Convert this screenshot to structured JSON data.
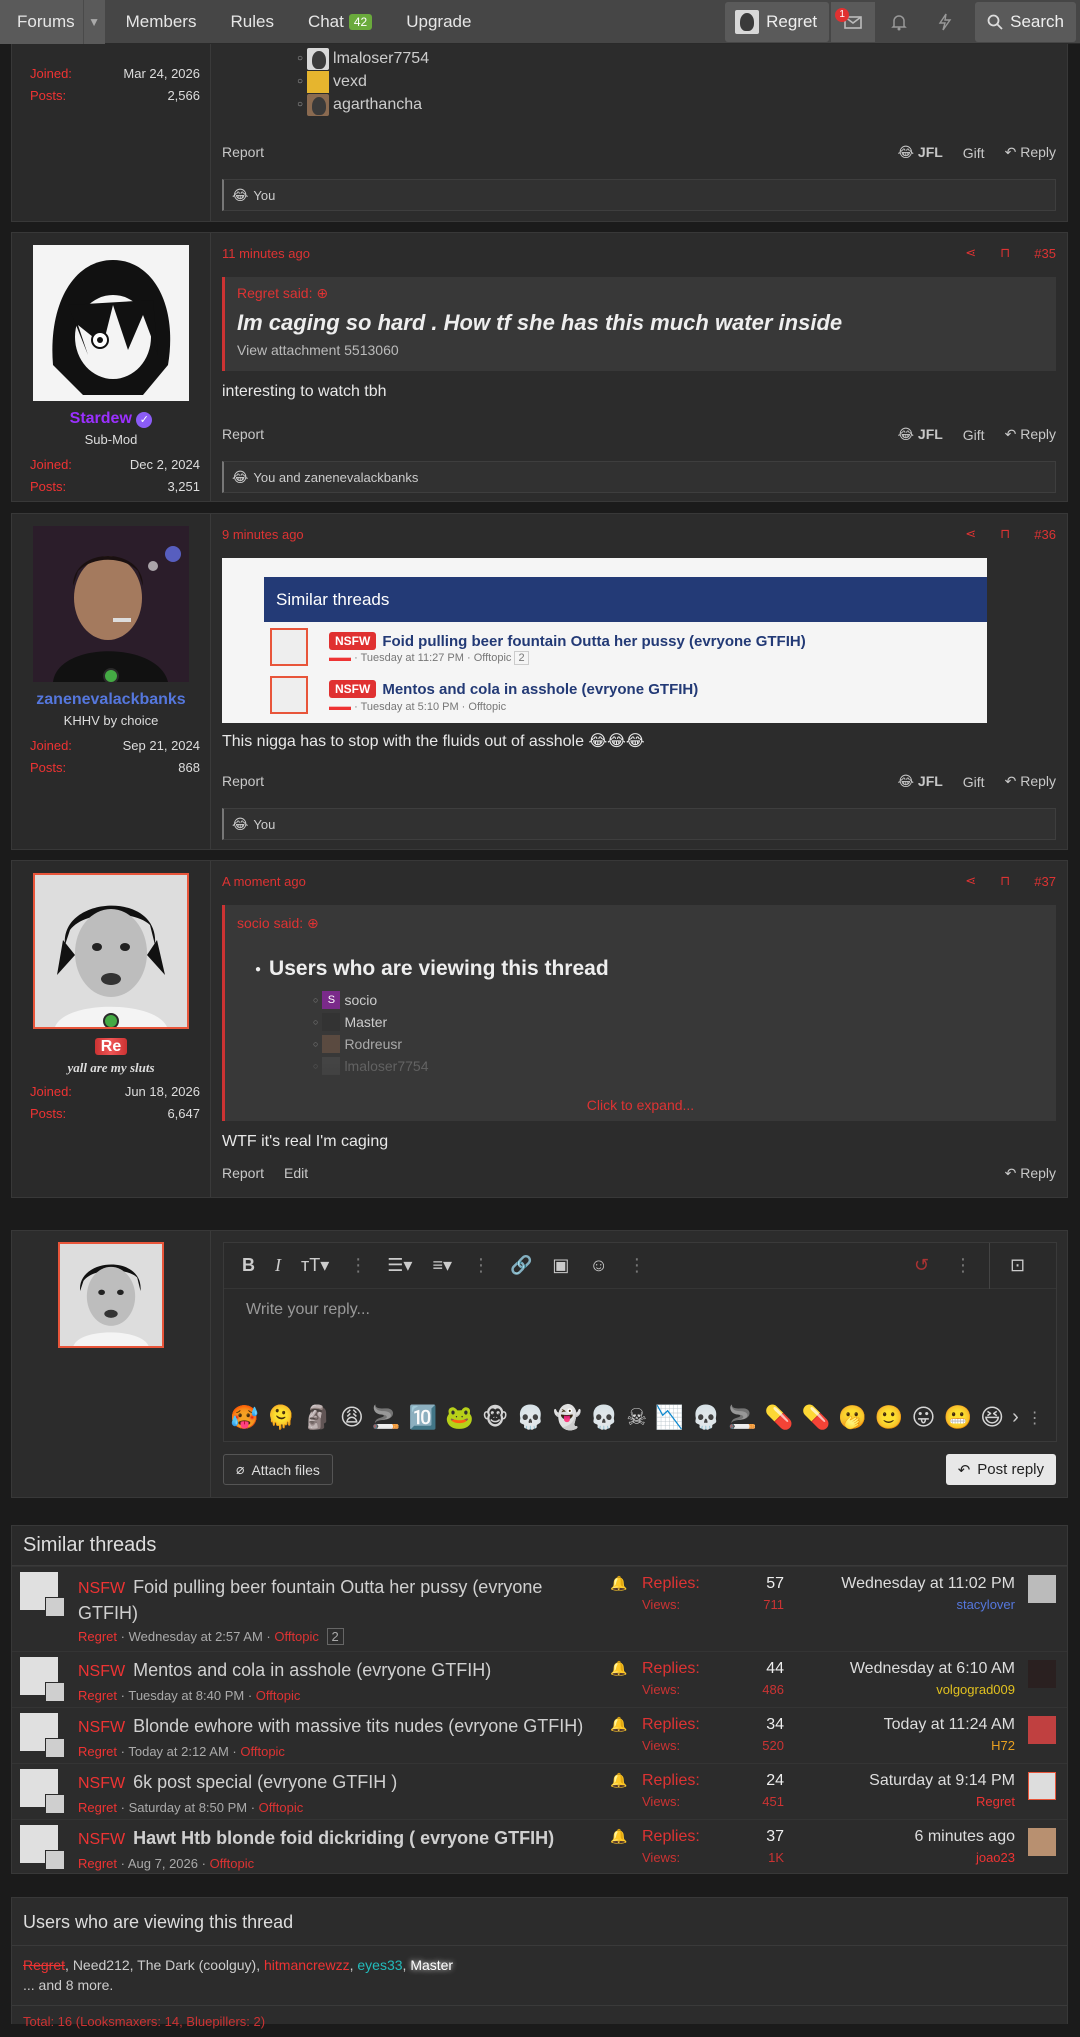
{
  "nav": {
    "forums": "Forums",
    "members": "Members",
    "rules": "Rules",
    "chat": "Chat",
    "chat_count": "42",
    "upgrade": "Upgrade",
    "user": "Regret",
    "notif_count": "1",
    "search": "Search"
  },
  "post0": {
    "viewers": [
      "lmaloser7754",
      "vexd",
      "agarthancha"
    ],
    "joined_label": "Joined:",
    "joined": "Mar 24, 2026",
    "posts_label": "Posts:",
    "posts": "2,566",
    "report": "Report",
    "jfl": "JFL",
    "gift": "Gift",
    "reply": "Reply",
    "reactions": "You"
  },
  "post35": {
    "time": "11 minutes ago",
    "num": "#35",
    "username": "Stardew",
    "title": "Sub-Mod",
    "joined_label": "Joined:",
    "joined": "Dec 2, 2024",
    "posts_label": "Posts:",
    "posts": "3,251",
    "quote_author": "Regret said:",
    "quote_text": "Im caging so hard . How tf she has this much water inside",
    "quote_attach": "View attachment 5513060",
    "body": "interesting to watch tbh",
    "report": "Report",
    "jfl": "JFL",
    "gift": "Gift",
    "reply": "Reply",
    "reactions": "You and zanenevalackbanks"
  },
  "post36": {
    "time": "9 minutes ago",
    "num": "#36",
    "username": "zanenevalackbanks",
    "title": "KHHV by choice",
    "joined_label": "Joined:",
    "joined": "Sep 21, 2024",
    "posts_label": "Posts:",
    "posts": "868",
    "embed_title": "Similar threads",
    "embed_t1_badge": "NSFW",
    "embed_t1": "Foid pulling beer fountain Outta her pussy (evryone GTFIH)",
    "embed_t1_meta": "· Tuesday at 11:27 PM · Offtopic",
    "embed_t1_pages": "2",
    "embed_t2_badge": "NSFW",
    "embed_t2": "Mentos and cola in asshole (evryone GTFIH)",
    "embed_t2_meta": "· Tuesday at 5:10 PM · Offtopic",
    "body": "This nigga has to stop with the fluids out of asshole 😂😂😂",
    "report": "Report",
    "jfl": "JFL",
    "gift": "Gift",
    "reply": "Reply",
    "reactions": "You"
  },
  "post37": {
    "time": "A moment ago",
    "num": "#37",
    "username": "Re",
    "title": "yall are my sluts",
    "joined_label": "Joined:",
    "joined": "Jun 18, 2026",
    "posts_label": "Posts:",
    "posts": "6,647",
    "quote_author": "socio said:",
    "quote_heading": "Users who are viewing this thread",
    "quote_users": [
      "socio",
      "Master",
      "Rodreusr",
      "lmaloser7754"
    ],
    "expand": "Click to expand...",
    "body": "WTF it's real I'm caging",
    "report": "Report",
    "edit": "Edit",
    "reply": "Reply"
  },
  "editor": {
    "placeholder": "Write your reply...",
    "attach": "Attach files",
    "post_reply": "Post reply"
  },
  "similar": {
    "title": "Similar threads",
    "replies_label": "Replies:",
    "views_label": "Views:",
    "threads": [
      {
        "prefix": "NSFW",
        "title": "Foid pulling beer fountain Outta her pussy (evryone GTFIH)",
        "author": "Regret",
        "date": "Wednesday at 2:57 AM",
        "forum": "Offtopic",
        "pages": "2",
        "replies": "57",
        "views": "711",
        "last_date": "Wednesday at 11:02 PM",
        "last_user": "stacylover",
        "last_color": "#5577dd"
      },
      {
        "prefix": "NSFW",
        "title": "Mentos and cola in asshole (evryone GTFIH)",
        "author": "Regret",
        "date": "Tuesday at 8:40 PM",
        "forum": "Offtopic",
        "pages": "",
        "replies": "44",
        "views": "486",
        "last_date": "Wednesday at 6:10 AM",
        "last_user": "volgograd009",
        "last_color": "#e0c020"
      },
      {
        "prefix": "NSFW",
        "title": "Blonde ewhore with massive tits nudes (evryone GTFIH)",
        "author": "Regret",
        "date": "Today at 2:12 AM",
        "forum": "Offtopic",
        "pages": "",
        "replies": "34",
        "views": "520",
        "last_date": "Today at 11:24 AM",
        "last_user": "H72",
        "last_color": "#e8a020"
      },
      {
        "prefix": "NSFW",
        "title": "6k post special (evryone GTFIH )",
        "author": "Regret",
        "date": "Saturday at 8:50 PM",
        "forum": "Offtopic",
        "pages": "",
        "replies": "24",
        "views": "451",
        "last_date": "Saturday at 9:14 PM",
        "last_user": "Regret",
        "last_color": "#e33"
      },
      {
        "prefix": "NSFW",
        "title": "Hawt Htb blonde foid dickriding ( evryone GTFIH)",
        "author": "Regret",
        "date": "Aug 7, 2026",
        "forum": "Offtopic",
        "pages": "",
        "replies": "37",
        "views": "1K",
        "last_date": "6 minutes ago",
        "last_user": "joao23",
        "last_color": "#e33"
      }
    ]
  },
  "viewing": {
    "title": "Users who are viewing this thread",
    "users": [
      {
        "name": "Regret",
        "color": "#e33"
      },
      {
        "name": "Need212",
        "color": "#ccc"
      },
      {
        "name": "The Dark (coolguy)",
        "color": "#ccc"
      },
      {
        "name": "hitmancrewzz",
        "color": "#e33"
      },
      {
        "name": "eyes33",
        "color": "#2bb"
      },
      {
        "name": "Master",
        "color": "#fff"
      }
    ],
    "more": "... and 8 more.",
    "total": "Total: 16 (Looksmaxers: 14, Bluepillers: 2)"
  },
  "colors": {
    "accent": "#dd3333",
    "online": "#44aa44",
    "stardew": "#9b30ff",
    "zane": "#5577dd"
  }
}
